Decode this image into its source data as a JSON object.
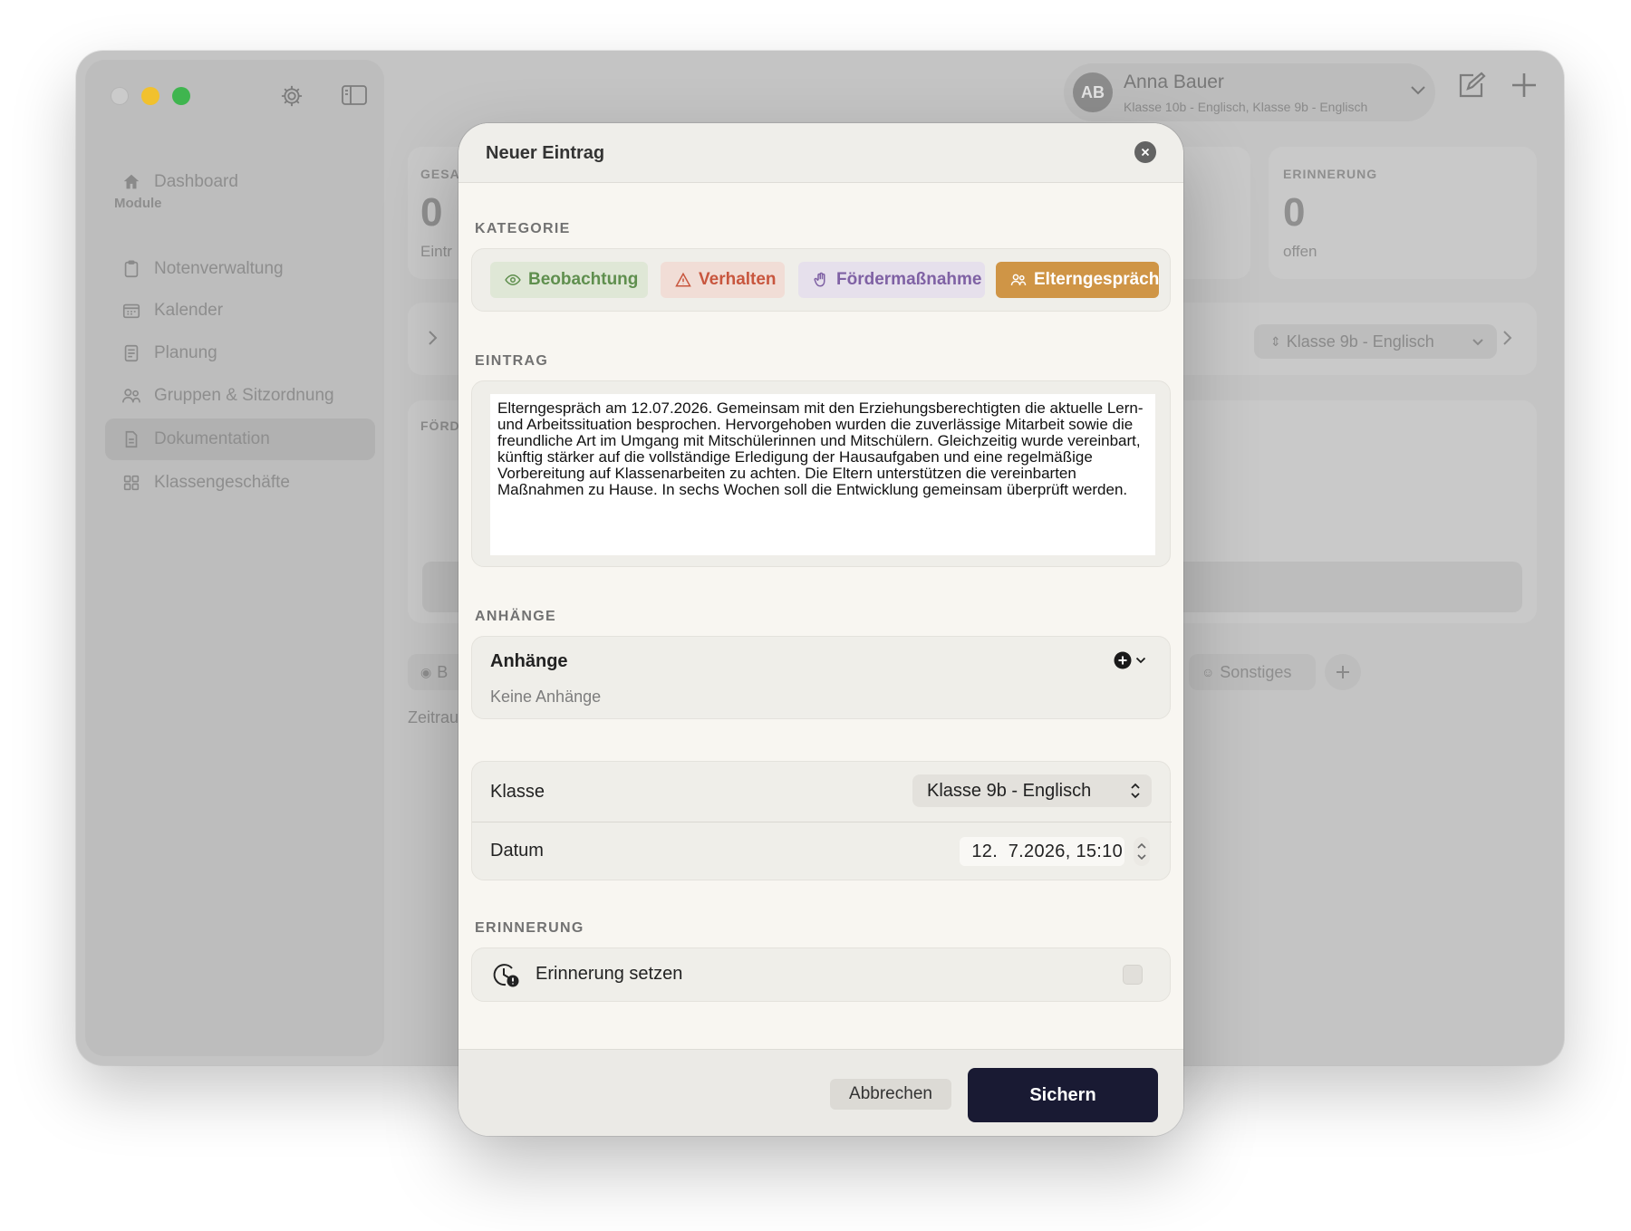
{
  "sidebar": {
    "dashboard": "Dashboard",
    "section": "Module",
    "items": [
      {
        "label": "Notenverwaltung"
      },
      {
        "label": "Kalender"
      },
      {
        "label": "Planung"
      },
      {
        "label": "Gruppen & Sitzordnung"
      },
      {
        "label": "Dokumentation"
      },
      {
        "label": "Klassengeschäfte"
      }
    ]
  },
  "user": {
    "initials": "AB",
    "name": "Anna Bauer",
    "subtitle": "Klasse 10b - Englisch, Klasse 9b - Englisch"
  },
  "background": {
    "card1_label": "GESA",
    "card1_value": "0",
    "card1_sub": "Eintr",
    "card2_label": "ERINNERUNG",
    "card2_value": "0",
    "card2_sub": "offen",
    "class_select": "Klasse 9b - Englisch",
    "foerder_label": "FÖRD",
    "pill_left": "B",
    "pill_sonstiges": "Sonstiges",
    "zeitraum": "Zeitrau"
  },
  "modal": {
    "title": "Neuer Eintrag",
    "kategorie_label": "KATEGORIE",
    "categories": {
      "beobachtung": "Beobachtung",
      "verhalten": "Verhalten",
      "foerdermassnahme": "Fördermaßnahme",
      "elterngespraech": "Elterngespräch"
    },
    "selected_category": "Elterngespräch",
    "eintrag_label": "EINTRAG",
    "eintrag_text": "Elterngespräch am 12.07.2026. Gemeinsam mit den Erziehungsberechtigten die aktuelle Lern- und Arbeitssituation besprochen. Hervorgehoben wurden die zuverlässige Mitarbeit sowie die freundliche Art im Umgang mit Mitschülerinnen und Mitschülern. Gleichzeitig wurde vereinbart, künftig stärker auf die vollständige Erledigung der Hausaufgaben und eine regelmäßige Vorbereitung auf Klassenarbeiten zu achten. Die Eltern unterstützen die vereinbarten Maßnahmen zu Hause. In sechs Wochen soll die Entwicklung gemeinsam überprüft werden.",
    "anhaenge_label": "ANHÄNGE",
    "anhaenge_title": "Anhänge",
    "anhaenge_empty": "Keine Anhänge",
    "klasse_label": "Klasse",
    "klasse_value": "Klasse 9b - Englisch",
    "datum_label": "Datum",
    "datum_value": "12.  7.2026, 15:10",
    "erinnerung_label": "ERINNERUNG",
    "erinnerung_text": "Erinnerung setzen",
    "erinnerung_checked": false,
    "cancel_label": "Abbrechen",
    "save_label": "Sichern"
  }
}
